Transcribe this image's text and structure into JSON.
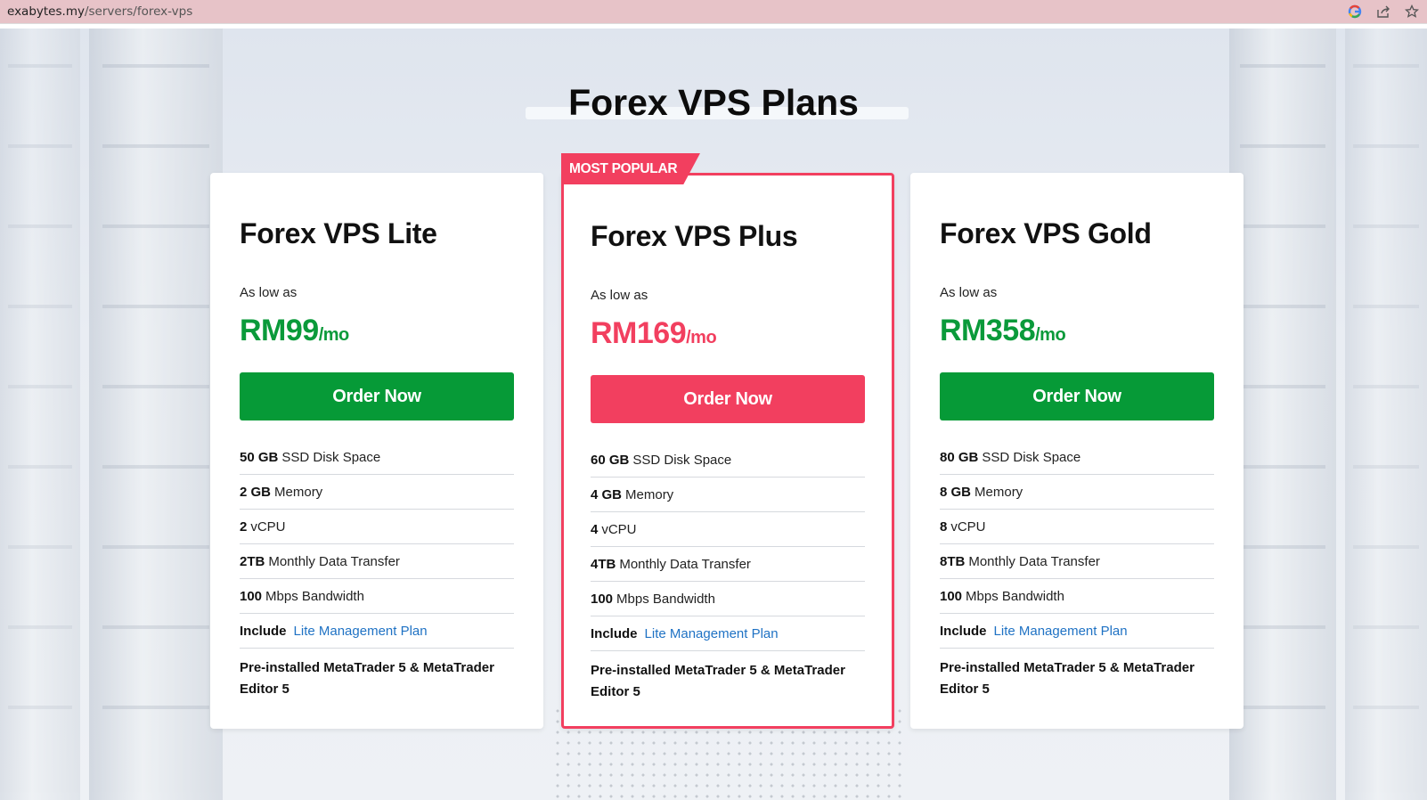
{
  "browser": {
    "url_domain": "exabytes.my",
    "url_path": "/servers/forex-vps",
    "icons": [
      "google-icon",
      "share-icon",
      "star-icon"
    ]
  },
  "page": {
    "title": "Forex VPS Plans"
  },
  "colors": {
    "green": "#069a37",
    "red": "#f23f5f",
    "link": "#1f72c4"
  },
  "plans": [
    {
      "name": "Forex VPS Lite",
      "as_low_as": "As low as",
      "price": "RM99",
      "period": "/mo",
      "order_label": "Order Now",
      "disk_value": "50 GB",
      "disk_label": "SSD Disk Space",
      "memory_value": "2 GB",
      "memory_label": "Memory",
      "vcpu_value": "2",
      "vcpu_label": "vCPU",
      "transfer_value": "2TB",
      "transfer_label": "Monthly Data Transfer",
      "bandwidth_value": "100",
      "bandwidth_label": "Mbps Bandwidth",
      "include_label": "Include",
      "include_link": "Lite Management Plan",
      "preinstalled": "Pre-installed MetaTrader 5 & MetaTrader Editor 5"
    },
    {
      "name": "Forex VPS Plus",
      "badge": "MOST POPULAR",
      "as_low_as": "As low as",
      "price": "RM169",
      "period": "/mo",
      "order_label": "Order Now",
      "disk_value": "60 GB",
      "disk_label": "SSD Disk Space",
      "memory_value": "4 GB",
      "memory_label": "Memory",
      "vcpu_value": "4",
      "vcpu_label": "vCPU",
      "transfer_value": "4TB",
      "transfer_label": "Monthly Data Transfer",
      "bandwidth_value": "100",
      "bandwidth_label": "Mbps Bandwidth",
      "include_label": "Include",
      "include_link": "Lite Management Plan",
      "preinstalled": "Pre-installed MetaTrader 5 & MetaTrader Editor 5"
    },
    {
      "name": "Forex VPS Gold",
      "as_low_as": "As low as",
      "price": "RM358",
      "period": "/mo",
      "order_label": "Order Now",
      "disk_value": "80 GB",
      "disk_label": "SSD Disk Space",
      "memory_value": "8 GB",
      "memory_label": "Memory",
      "vcpu_value": "8",
      "vcpu_label": "vCPU",
      "transfer_value": "8TB",
      "transfer_label": "Monthly Data Transfer",
      "bandwidth_value": "100",
      "bandwidth_label": "Mbps Bandwidth",
      "include_label": "Include",
      "include_link": "Lite Management Plan",
      "preinstalled": "Pre-installed MetaTrader 5 & MetaTrader Editor 5"
    }
  ]
}
